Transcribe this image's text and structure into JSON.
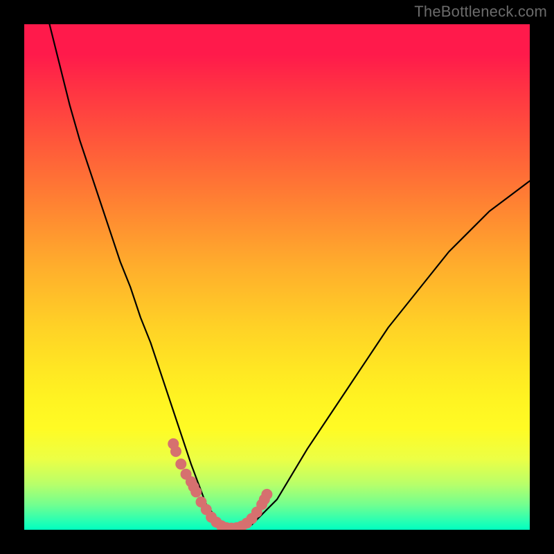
{
  "watermark": "TheBottleneck.com",
  "colors": {
    "frame_bg": "#000000",
    "gradient_stops": [
      "#ff1a4b",
      "#ff3044",
      "#ff5a3a",
      "#ff8432",
      "#ffae2c",
      "#ffd226",
      "#ffe623",
      "#fff322",
      "#fffb24",
      "#ecff45",
      "#b8ff6a",
      "#73ff8f",
      "#2effb0",
      "#00ffc0"
    ],
    "curve_stroke": "#000000",
    "marker_stroke": "#d6706f",
    "watermark_color": "#6b6b6b"
  },
  "chart_data": {
    "type": "line",
    "title": "",
    "xlabel": "",
    "ylabel": "",
    "xlim": [
      0,
      100
    ],
    "ylim": [
      0,
      100
    ],
    "grid": false,
    "legend": false,
    "series": [
      {
        "name": "bottleneck-curve",
        "x": [
          5,
          7,
          9,
          11,
          13,
          15,
          17,
          19,
          21,
          23,
          25,
          27,
          29,
          31,
          33,
          34.5,
          36,
          37.5,
          39,
          41,
          43,
          45,
          47,
          50,
          53,
          56,
          60,
          64,
          68,
          72,
          76,
          80,
          84,
          88,
          92,
          96,
          100
        ],
        "y": [
          100,
          92,
          84,
          77,
          71,
          65,
          59,
          53,
          48,
          42,
          37,
          31,
          25,
          19,
          13,
          9,
          5,
          3,
          1,
          0,
          0,
          1,
          3,
          6,
          11,
          16,
          22,
          28,
          34,
          40,
          45,
          50,
          55,
          59,
          63,
          66,
          69
        ]
      }
    ],
    "markers": [
      {
        "name": "optimal-range-markers",
        "x": [
          29.5,
          30.0,
          31.0,
          32.0,
          33.0,
          33.5,
          34.0,
          35.0,
          36.0,
          37.0,
          38.0,
          39.0,
          40.0,
          41.0,
          42.0,
          43.0,
          44.0,
          45.0,
          46.0,
          47.0,
          47.5,
          48.0
        ],
        "y": [
          17,
          15.5,
          13,
          11,
          9.5,
          8.5,
          7.5,
          5.5,
          4,
          2.5,
          1.5,
          0.8,
          0.4,
          0.3,
          0.4,
          0.7,
          1.3,
          2.2,
          3.5,
          5,
          6,
          7
        ]
      }
    ]
  }
}
